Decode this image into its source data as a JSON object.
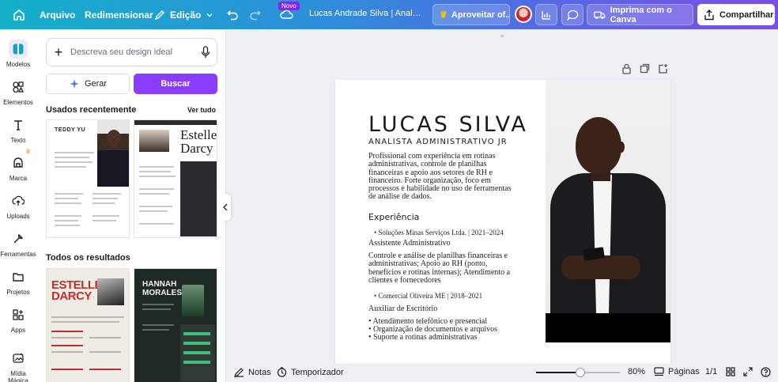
{
  "topbar": {
    "home_icon": "home-icon",
    "menu_arquivo": "Arquivo",
    "menu_redimensionar": "Redimensionar",
    "menu_edicao": "Edição",
    "novo_badge": "Novo",
    "doc_title": "Lucas Andrade Silva | Analist ...",
    "trial_button": "Aproveitar of...",
    "print_button": "Imprima com o Canva",
    "share_button": "Compartilhar"
  },
  "rail": {
    "items": [
      {
        "label": "Modelos",
        "icon": "templates-icon"
      },
      {
        "label": "Elementos",
        "icon": "elements-icon"
      },
      {
        "label": "Texto",
        "icon": "text-icon"
      },
      {
        "label": "Marca",
        "icon": "brand-icon"
      },
      {
        "label": "Uploads",
        "icon": "upload-icon"
      },
      {
        "label": "Ferramentas",
        "icon": "tools-icon"
      },
      {
        "label": "Projetos",
        "icon": "folder-icon"
      },
      {
        "label": "Apps",
        "icon": "apps-icon"
      },
      {
        "label": "Mídia Mágica",
        "icon": "magic-media-icon"
      }
    ]
  },
  "panel": {
    "search_placeholder": "Descreva seu design ideal",
    "generate_button": "Gerar",
    "search_button": "Buscar",
    "recent_title": "Usados recentemente",
    "see_all": "Ver tudo",
    "results_title": "Todos os resultados",
    "thumbs": {
      "t1_name": "TEDDY YU",
      "t2_name": "Estelle Darcy",
      "t3_name": "ESTELLE DARCY",
      "t4_name": "HANNAH MORALES"
    }
  },
  "resume": {
    "name": "LUCAS SILVA",
    "role": "ANALISTA ADMINISTRATIVO JR",
    "summary": "Profissional com experiência em rotinas administrativas, controle de planilhas financeiras e apoio aos setores de RH e financeiro. Forte organização, foco em processos e habilidade no uso de ferramentas de análise de dados.",
    "experience_title": "Experiência",
    "job1_line": "• Soluções Minas Serviços Ltda. | 2021–2024",
    "job1_title": "Assistente Administrativo",
    "job1_desc": "Controle e análise de planilhas financeiras e administrativas; Apoio ao RH (ponto, benefícios e rotinas internas); Atendimento a clientes e fornecedores",
    "job2_line": "• Comercial Oliveira ME | 2018–2021",
    "job2_title": "Auxiliar de Escritório",
    "job2_bullets": [
      "• Atendimento telefônico e presencial",
      "• Organização de documentos e arquivos",
      "• Suporte a rotinas administrativas"
    ]
  },
  "bottombar": {
    "notes": "Notas",
    "timer": "Temporizador",
    "zoom_value": 80,
    "zoom_label": "80%",
    "pages": "Páginas",
    "page_counter": "1/1"
  }
}
